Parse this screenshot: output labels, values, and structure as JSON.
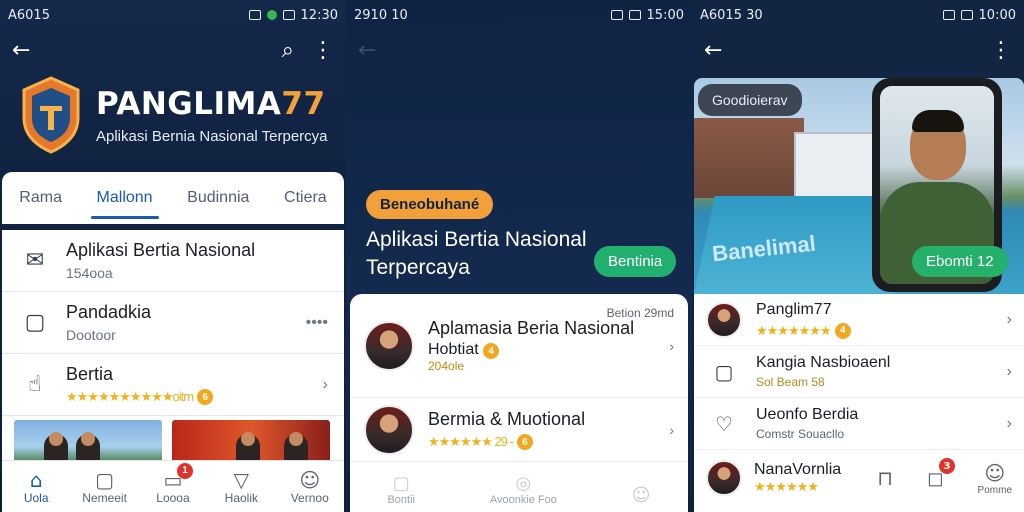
{
  "panel1": {
    "status": {
      "left": "A6015",
      "right": "12:30"
    },
    "brand": {
      "title_main": "PANGLIMA",
      "title_num": "77",
      "subtitle": "Aplikasi Bernia Nasional Terpercya"
    },
    "tabs": [
      "Rama",
      "Mallonn",
      "Budinnia",
      "Ctiera"
    ],
    "active_tab": "Mallonn",
    "items": [
      {
        "title": "Aplikasi Bertia Nasional",
        "subtitle": "154ooa",
        "icon": "envelope-open-icon"
      },
      {
        "title": "Pandadkia",
        "subtitle": "Dootoor",
        "icon": "box-icon",
        "trail": "••••"
      },
      {
        "title": "Bertia",
        "rating_text": "★★★★★★★★★★oitm",
        "coin": "6",
        "icon": "hand-icon",
        "trail": "›"
      }
    ],
    "nav": [
      {
        "label": "Uola",
        "icon": "home-icon"
      },
      {
        "label": "Nemeeit",
        "icon": "square-icon"
      },
      {
        "label": "Loooa",
        "icon": "chat-icon",
        "badge": "1"
      },
      {
        "label": "Haolik",
        "icon": "triangle-icon"
      },
      {
        "label": "Vernoo",
        "icon": "user-icon"
      }
    ]
  },
  "panel2": {
    "status": {
      "left": "2910 10",
      "right": "15:00"
    },
    "pill": "Beneobuhané",
    "hero_title": "Aplikasi Bertia Nasional Terpercaya",
    "cta": "Bentinia",
    "meta": "Betion 29md",
    "items": [
      {
        "title": "Aplamasia Beria Nasional",
        "subtitle": "Hobtiat",
        "coin": "4",
        "tag": "204ole"
      },
      {
        "title": "Bermia & Muotional",
        "rating": "★★★★★★ 29 -",
        "coin": "6"
      }
    ],
    "ghost_nav": [
      "Bontii",
      "Avoonkie Foo",
      ""
    ]
  },
  "panel3": {
    "status": {
      "left": "A6015 30",
      "right": "10:00"
    },
    "overlay_pill": "Goodioierav",
    "watermark": "Banelimal",
    "cta": "Ebomti 12",
    "items": [
      {
        "title": "Panglim77",
        "rating": "★★★★★★★",
        "coin": "4",
        "icon": "avatar"
      },
      {
        "title": "Kangia Nasbioaenl",
        "subtitle": "Sol Beam 58",
        "icon": "box-icon"
      },
      {
        "title": "Ueonfo Berdia",
        "subtitle": "Comstr Souacllo",
        "icon": "heart-icon"
      }
    ],
    "bottom": {
      "title": "NanaVornlia",
      "rating": "★★★★★★"
    },
    "bottom_nav": [
      {
        "label": "",
        "icon": "chair-icon"
      },
      {
        "label": "",
        "icon": "chat-icon",
        "badge": "3"
      },
      {
        "label": "Pomme",
        "icon": "user-icon"
      }
    ]
  }
}
